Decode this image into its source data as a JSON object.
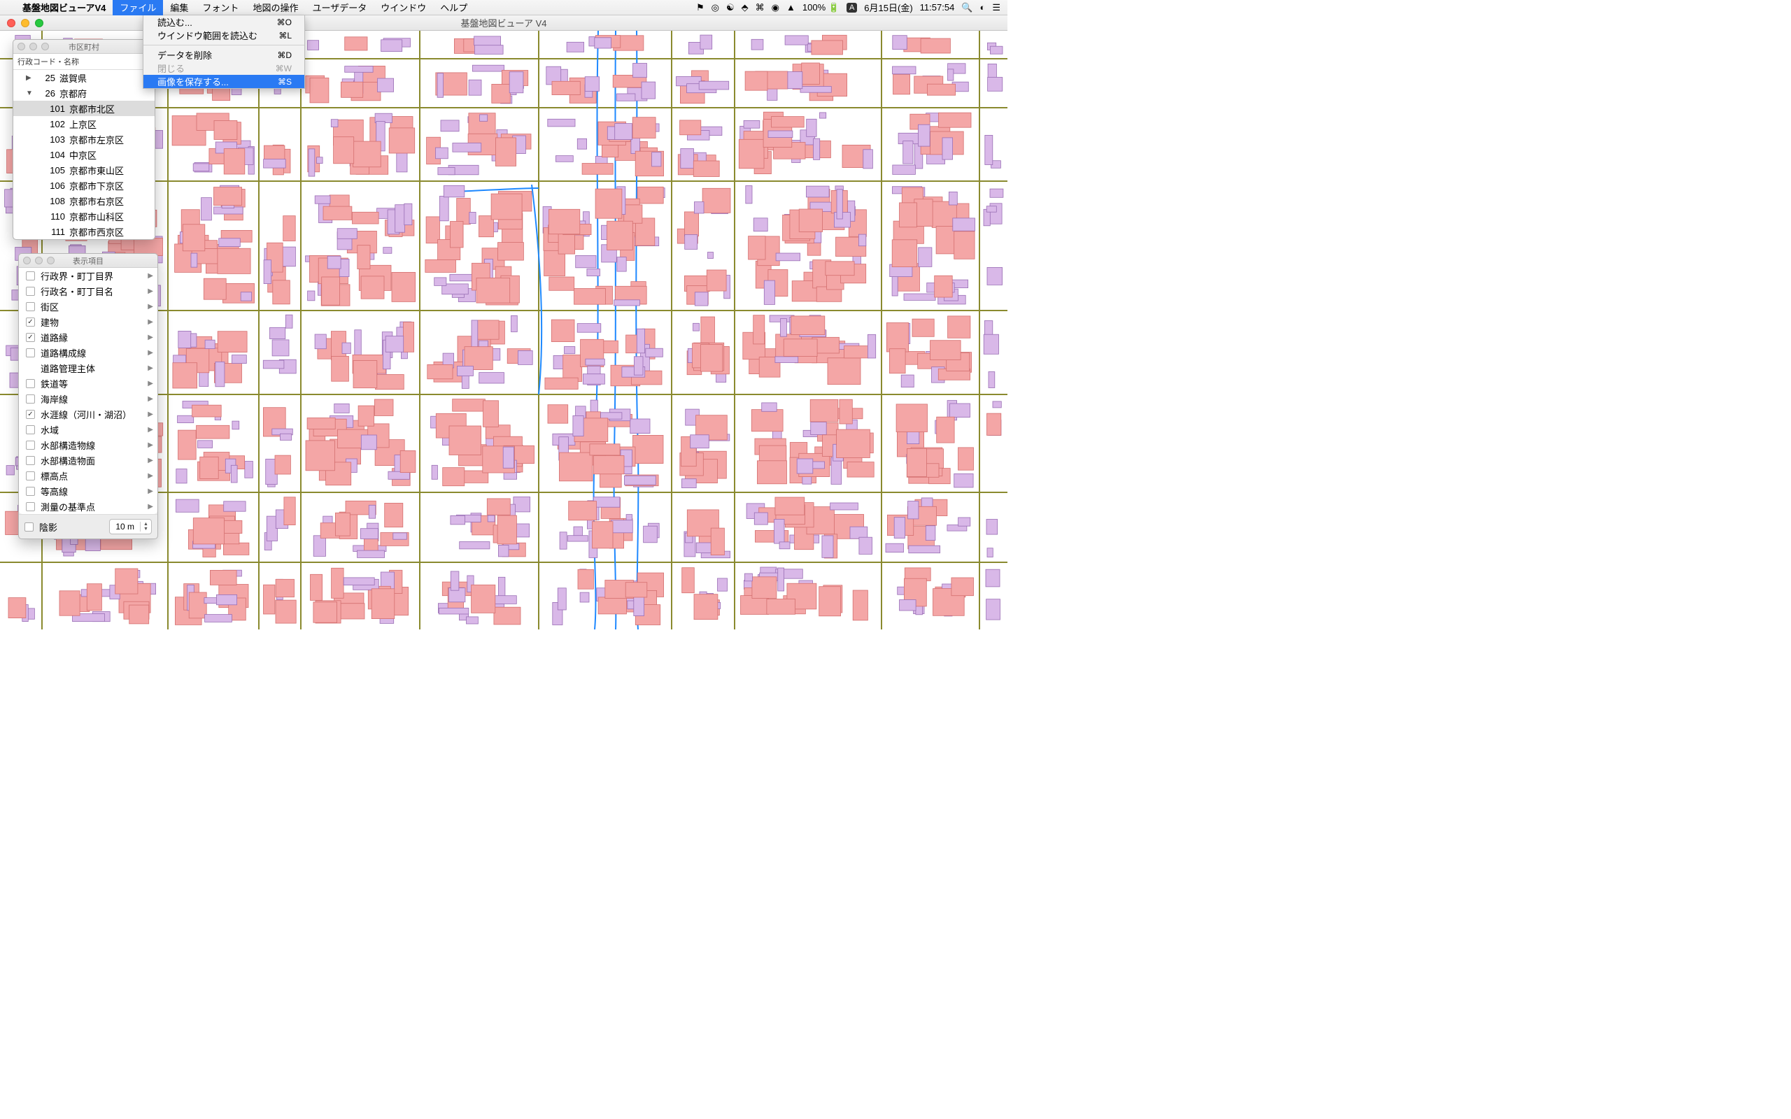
{
  "menubar": {
    "app_name": "基盤地図ビューアV4",
    "items": [
      "ファイル",
      "編集",
      "フォント",
      "地図の操作",
      "ユーザデータ",
      "ウインドウ",
      "ヘルプ"
    ],
    "active_index": 0,
    "status": {
      "battery": "100%",
      "ime_label": "A",
      "date": "6月15日(金)",
      "time": "11:57:54"
    }
  },
  "dropdown": {
    "items": [
      {
        "label": "読込む...",
        "shortcut": "⌘O"
      },
      {
        "label": "ウインドウ範囲を読込む",
        "shortcut": "⌘L"
      },
      {
        "sep": true
      },
      {
        "label": "データを削除",
        "shortcut": "⌘D"
      },
      {
        "label": "閉じる",
        "shortcut": "⌘W",
        "disabled": true
      },
      {
        "label": "画像を保存する...",
        "shortcut": "⌘S",
        "selected": true
      }
    ]
  },
  "window": {
    "title": "基盤地図ビューア V4"
  },
  "municipality_panel": {
    "title": "市区町村",
    "header": "行政コード・名称",
    "rows": [
      {
        "disclosure": "▶",
        "code": "25",
        "label": "滋賀県",
        "indent": 1
      },
      {
        "disclosure": "▼",
        "code": "26",
        "label": "京都府",
        "indent": 1
      },
      {
        "code": "101",
        "label": "京都市北区",
        "indent": 2,
        "selected": true
      },
      {
        "code": "102",
        "label": "上京区",
        "indent": 2
      },
      {
        "code": "103",
        "label": "京都市左京区",
        "indent": 2
      },
      {
        "code": "104",
        "label": "中京区",
        "indent": 2
      },
      {
        "code": "105",
        "label": "京都市東山区",
        "indent": 2
      },
      {
        "code": "106",
        "label": "京都市下京区",
        "indent": 2
      },
      {
        "code": "108",
        "label": "京都市右京区",
        "indent": 2
      },
      {
        "code": "110",
        "label": "京都市山科区",
        "indent": 2
      },
      {
        "code": "111",
        "label": "京都市西京区",
        "indent": 2
      }
    ]
  },
  "layers_panel": {
    "title": "表示項目",
    "rows": [
      {
        "label": "行政界・町丁目界",
        "checked": false,
        "arrow": true
      },
      {
        "label": "行政名・町丁目名",
        "checked": false,
        "arrow": true
      },
      {
        "label": "街区",
        "checked": false,
        "arrow": true
      },
      {
        "label": "建物",
        "checked": true,
        "arrow": true
      },
      {
        "label": "道路縁",
        "checked": true,
        "arrow": true
      },
      {
        "label": "道路構成線",
        "checked": false,
        "arrow": true
      },
      {
        "label": "道路管理主体",
        "checked": false,
        "arrow": true,
        "no_cb": true
      },
      {
        "label": "鉄道等",
        "checked": false,
        "arrow": true
      },
      {
        "label": "海岸線",
        "checked": false,
        "arrow": true
      },
      {
        "label": "水涯線（河川・湖沼）",
        "checked": true,
        "arrow": true
      },
      {
        "label": "水域",
        "checked": false,
        "arrow": true
      },
      {
        "label": "水部構造物線",
        "checked": false,
        "arrow": true
      },
      {
        "label": "水部構造物面",
        "checked": false,
        "arrow": true
      },
      {
        "label": "標高点",
        "checked": false,
        "arrow": true
      },
      {
        "label": "等高線",
        "checked": false,
        "arrow": true
      },
      {
        "label": "測量の基準点",
        "checked": false,
        "arrow": true
      }
    ],
    "footer": {
      "shadow_label": "陰影",
      "value": "10 m"
    }
  }
}
